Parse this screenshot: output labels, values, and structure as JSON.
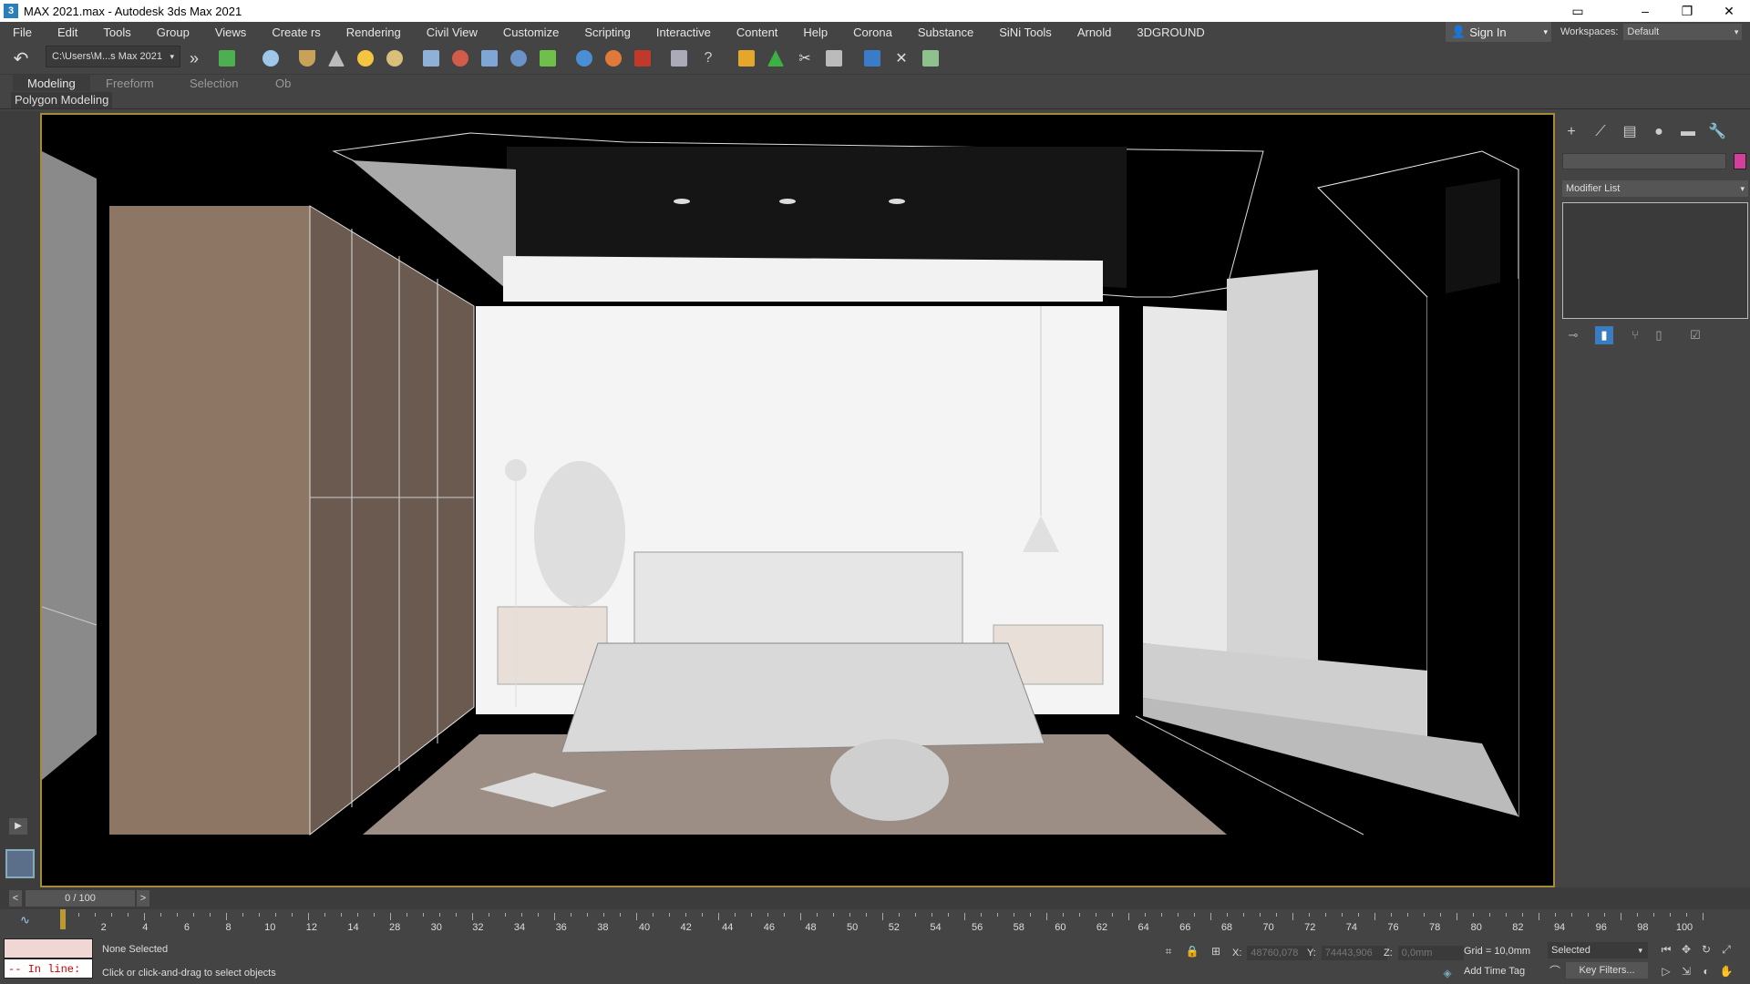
{
  "window": {
    "title": "MAX 2021.max - Autodesk 3ds Max 2021",
    "app_icon": "3",
    "min": "–",
    "restore": "❐",
    "close": "✕"
  },
  "menu": [
    "File",
    "Edit",
    "Tools",
    "Group",
    "Views",
    "Create rs",
    "Rendering",
    "Civil View",
    "Customize",
    "Scripting",
    "Interactive",
    "Content",
    "Help",
    "Corona",
    "Substance",
    "SiNi Tools",
    "Arnold",
    "3DGROUND"
  ],
  "signin": {
    "label": "Sign In",
    "arrow": "▾"
  },
  "workspaces": {
    "label": "Workspaces:",
    "value": "Default",
    "arrow": "▾"
  },
  "toolbar": {
    "path": "C:\\Users\\M...s Max 2021",
    "path_arrow": "▾",
    "more": "»",
    "undo": "↶"
  },
  "ribbon": {
    "tabs": [
      "Modeling",
      "Freeform",
      "Selection",
      "Ob"
    ],
    "panel": "Polygon Modeling"
  },
  "command_panel": {
    "modifier_list": "Modifier List",
    "arrow": "▾",
    "tabs": [
      "+",
      "⟋",
      "▤",
      "●",
      "▬",
      "🔧"
    ],
    "stack_buttons": [
      "⊸",
      "▮",
      "⑂",
      "▯",
      "☑"
    ]
  },
  "left_strip": {
    "play": "▶"
  },
  "timeline": {
    "frame": "0 / 100",
    "prev": "<",
    "next": ">",
    "curve": "∿",
    "labels": [
      "2",
      "4",
      "6",
      "8",
      "10",
      "12",
      "14",
      "28",
      "30",
      "32",
      "34",
      "36",
      "38",
      "40",
      "42",
      "44",
      "46",
      "48",
      "50",
      "52",
      "54",
      "56",
      "58",
      "60",
      "62",
      "64",
      "66",
      "68",
      "70",
      "72",
      "74",
      "76",
      "78",
      "80",
      "82",
      "94",
      "96",
      "98",
      "100"
    ]
  },
  "status": {
    "inline": "-- In line:",
    "selection": "None Selected",
    "prompt": "Click or click-and-drag to select objects",
    "x_label": "X:",
    "x_value": "48760,078",
    "y_label": "Y:",
    "y_value": "74443,906",
    "z_label": "Z:",
    "z_value": "0,0mm",
    "grid": "Grid = 10,0mm",
    "selected": "Selected",
    "add_time_tag": "Add Time Tag",
    "key_filters": "Key Filters..."
  },
  "colors": {
    "viewport_border": "#a58a3a",
    "swatch": "#d43f9a",
    "accent": "#3b7bbf"
  }
}
